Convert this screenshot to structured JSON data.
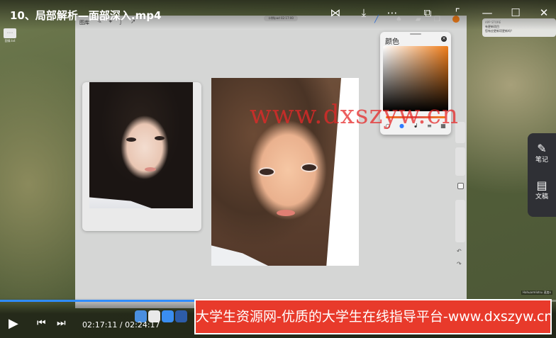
{
  "player": {
    "title": "10、局部解析—面部深入.mp4",
    "current_time": "02:17:11",
    "separator": "/",
    "total_time": "02:24:17",
    "progress": 0.95,
    "accent_color": "#2f8cff",
    "controls": [
      "share-icon",
      "download-icon",
      "more-icon",
      "pip-icon",
      "minimize-icon",
      "maximize-icon",
      "close-icon"
    ]
  },
  "ipad": {
    "gallery_label": "图库",
    "notch_label": "卡掰Ipad 02:17:00"
  },
  "color_panel": {
    "title": "颜色",
    "current_color": "#f07d1a",
    "tabs": [
      "disc-icon",
      "classic-icon",
      "harmony-icon",
      "value-icon",
      "palette-icon"
    ]
  },
  "notification": {
    "app": "APP STORE",
    "line1": "有更新项目",
    "line2": "您有应更新项更新吗？"
  },
  "desktop_icon": {
    "glyph": "◦◦◦",
    "label": "国情.txt"
  },
  "side_panel": {
    "items": [
      {
        "label": "笔记",
        "icon": "note-edit-icon"
      },
      {
        "label": "文稿",
        "icon": "document-ai-icon"
      }
    ]
  },
  "watermark": "www.dxszyw.cn",
  "banner": "大学生资源网-优质的大学生在线指导平台-www.dxszyw.cn",
  "tiny_caption": "Hahuarmlotsu 速度x"
}
